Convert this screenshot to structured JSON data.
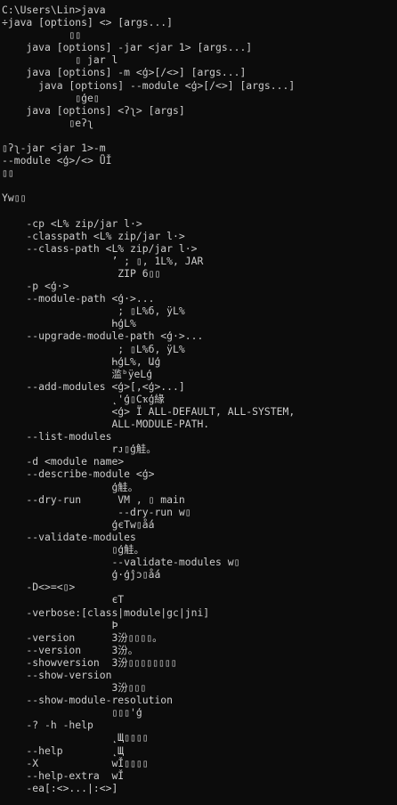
{
  "window": {
    "background": "#0c0c0c",
    "foreground": "#cccccc"
  },
  "terminal": {
    "lines": [
      "C:\\Users\\Lin>java",
      "÷java [options] <> [args...]",
      "           ▯▯",
      "    java [options] -jar <jar 1> [args...]",
      "            ▯ jar l",
      "    java [options] -m <ģ>[/<>] [args...]",
      "      java [options] --module <ģ>[/<>] [args...]",
      "            ▯ģe▯",
      "    java [options] <ʔʅ> [args]",
      "           ▯eʔʅ",
      "",
      "▯ʔʅ-jar <jar 1>-m",
      "--module <ģ>/<> ǕǏ",
      "▯▯",
      "",
      "Yw▯▯",
      "",
      "    -cp <L% zip/jar l·>",
      "    -classpath <L% zip/jar l·>",
      "    --class-path <L% zip/jar l·>",
      "                  ’ ; ▯, 1L%, JAR",
      "                   ZIP 6▯▯",
      "    -p <ģ·>",
      "    --module-path <ģ·>...",
      "                   ; ▯L%б, ÿL%",
      "                  ҺģL%",
      "    --upgrade-module-path <ģ·>...",
      "                   ; ▯L%б, ÿL%",
      "                  ҺģL%, Աģ",
      "                  滥ᵇÿeLģ",
      "    --add-modules <ģ>[,<ģ>...]",
      "                  ˛'ģ▯Cҡģ緣",
      "                  <ģ> Ï ALL-DEFAULT, ALL-SYSTEM,",
      "                  ALL-MODULE-PATH.",
      "    --list-modules",
      "                  rᴊ▯ģ觟。",
      "    -d <module name>",
      "    --describe-module <ģ>",
      "                  ģ觟。",
      "    --dry-run      VM , ▯ main",
      "                   --dry-run w▯",
      "                  ģєTw▯ǻá",
      "    --validate-modules",
      "                  ▯ģ觟。",
      "                  --validate-modules w▯",
      "                  ģ·ģĵɔ▯ǻá",
      "    -D<>=<▯>",
      "                  єT",
      "    -verbose:[class|module|gc|jni]",
      "                  Ϸ",
      "    -version      3汾▯▯▯▯。",
      "    --version     3汾。",
      "    -showversion  3汾▯▯▯▯▯▯▯▯",
      "    --show-version",
      "                  3汾▯▯▯",
      "    --show-module-resolution",
      "                  ▯▯▯'ģ",
      "    -? -h -help",
      "                  ˛Щ▯▯▯▯",
      "    --help        ˛Щ",
      "    -X            wǏ▯▯▯▯",
      "    --help-extra  wǏ",
      "    -ea[:<>...|:<>]"
    ]
  }
}
